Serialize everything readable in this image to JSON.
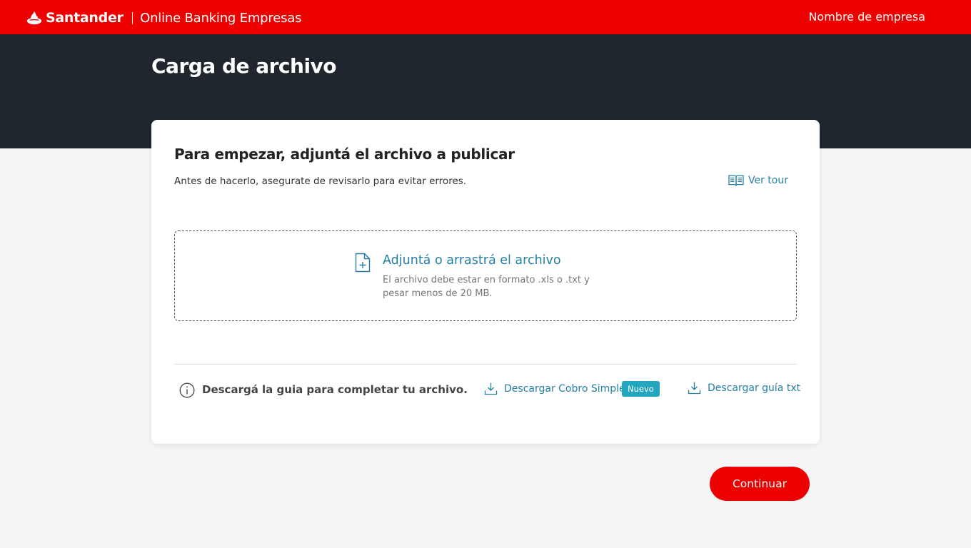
{
  "header": {
    "brand_name": "Santander",
    "product_name": "Online Banking Empresas",
    "company_name": "Nombre de empresa",
    "background_color": "#ec0000"
  },
  "hero": {
    "page_title": "Carga de archivo",
    "background_color": "#1f262d"
  },
  "card": {
    "title": "Para empezar, adjuntá el archivo a publicar",
    "subtitle": "Antes de hacerlo, asegurate de revisarlo para evitar errores.",
    "tour_label": "Ver tour",
    "tour_icon": "book-open-icon",
    "dropzone": {
      "icon": "file-add-icon",
      "title": "Adjuntá o arrastrá el archivo",
      "hint": "El archivo debe estar en formato .xls o .txt y pesar menos de 20 MB."
    },
    "guide": {
      "icon": "info-icon",
      "text": "Descargá la guia para completar tu archivo.",
      "links": [
        {
          "label": "Descargar Cobro Simple",
          "icon": "download-icon",
          "badge": "Nuevo"
        },
        {
          "label": "Descargar guía txt",
          "icon": "download-icon"
        }
      ]
    }
  },
  "actions": {
    "continue_label": "Continuar"
  },
  "colors": {
    "brand_red": "#ec0000",
    "link_blue": "#257fa4",
    "badge_teal": "#23a7bf"
  }
}
